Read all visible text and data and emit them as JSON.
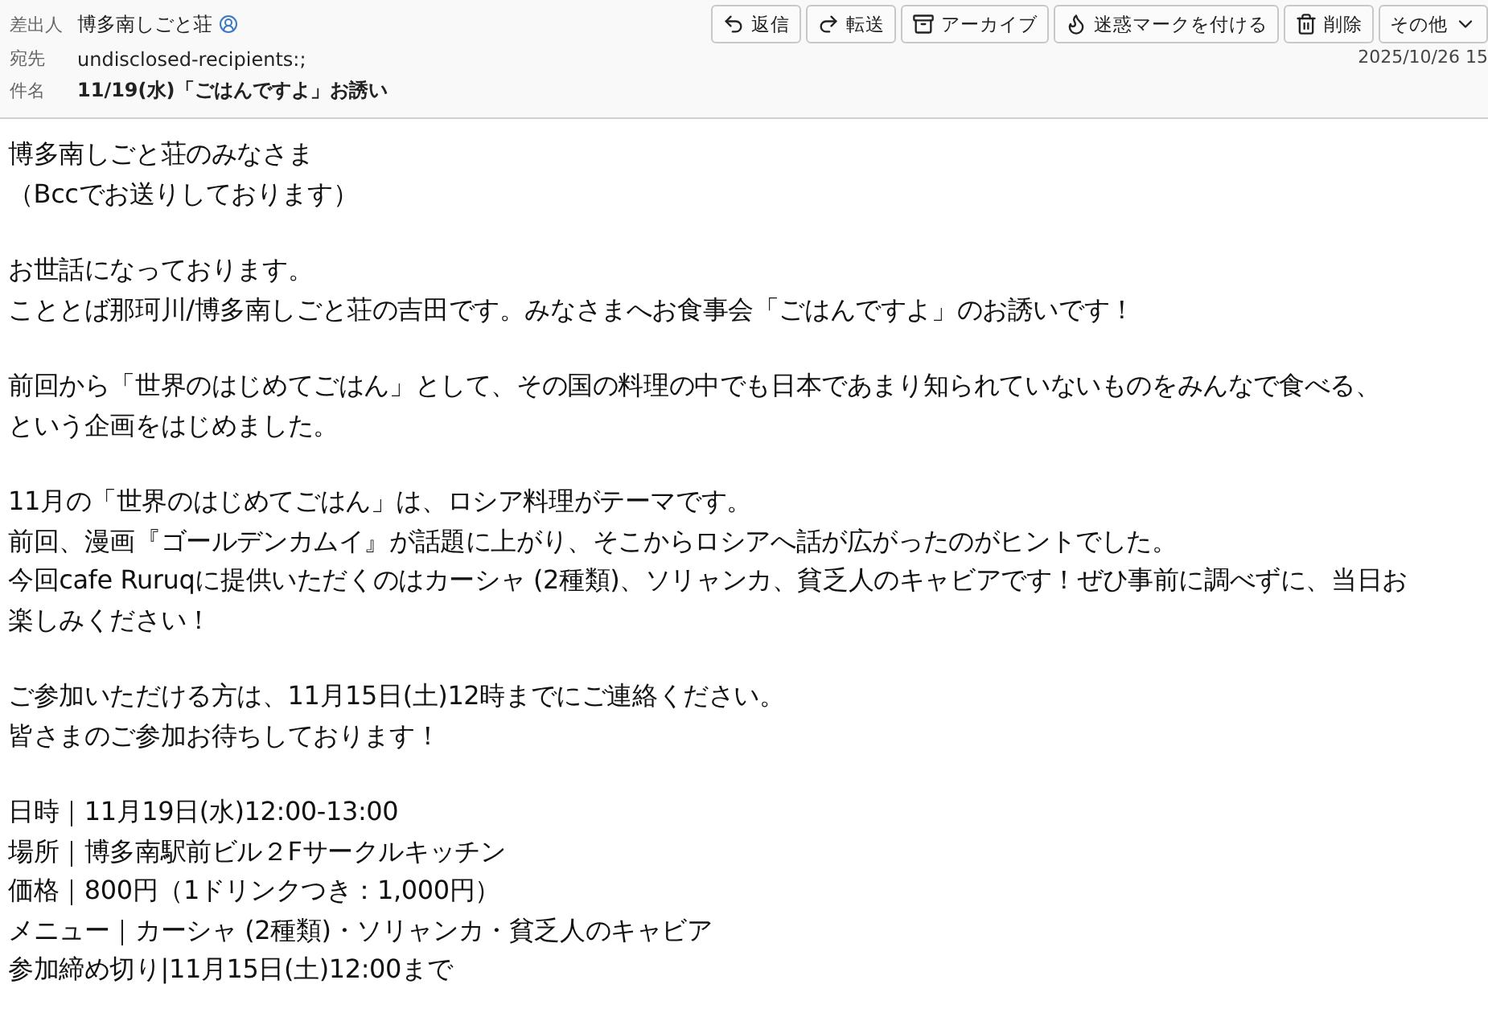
{
  "header": {
    "fields": [
      {
        "label": "差出人",
        "value": "博多南しごと荘",
        "kind": "sender"
      },
      {
        "label": "宛先",
        "value": "undisclosed-recipients:;",
        "kind": "plain"
      },
      {
        "label": "件名",
        "value": "11/19(水)「ごはんですよ」お誘い",
        "kind": "subject"
      }
    ],
    "actions": [
      {
        "label": "返信",
        "kind": "reply"
      },
      {
        "label": "転送",
        "kind": "forward"
      },
      {
        "label": "アーカイブ",
        "kind": "archive"
      },
      {
        "label": "迷惑マークを付ける",
        "kind": "junk"
      },
      {
        "label": "削除",
        "kind": "delete"
      },
      {
        "label": "その他",
        "kind": "more"
      }
    ],
    "date": "2025/10/26 15"
  },
  "body": [
    [
      "博多南しごと荘のみなさま",
      "（Bccでお送りしております）"
    ],
    [
      "お世話になっております。",
      "こととば那珂川/博多南しごと荘の吉田です。みなさまへお食事会「ごはんですよ」のお誘いです！"
    ],
    [
      "前回から「世界のはじめてごはん」として、その国の料理の中でも日本であまり知られていないものをみんなで食べる、",
      "という企画をはじめました。"
    ],
    [
      "11月の「世界のはじめてごはん」は、ロシア料理がテーマです。",
      "前回、漫画『ゴールデンカムイ』が話題に上がり、そこからロシアへ話が広がったのがヒントでした。",
      "今回cafe Ruruqに提供いただくのはカーシャ (2種類)、ソリャンカ、貧乏人のキャビアです！ぜひ事前に調べずに、当日お",
      "楽しみください！"
    ],
    [
      "ご参加いただける方は、11月15日(土)12時までにご連絡ください。",
      "皆さまのご参加お待ちしております！"
    ],
    [
      "日時｜11月19日(水)12:00-13:00",
      "場所｜博多南駅前ビル２Fサークルキッチン",
      "価格｜800円（1ドリンクつき：1,000円）",
      "メニュー｜カーシャ (2種類)・ソリャンカ・貧乏人のキャビア",
      "参加締め切り|11月15日(土)12:00まで"
    ]
  ]
}
